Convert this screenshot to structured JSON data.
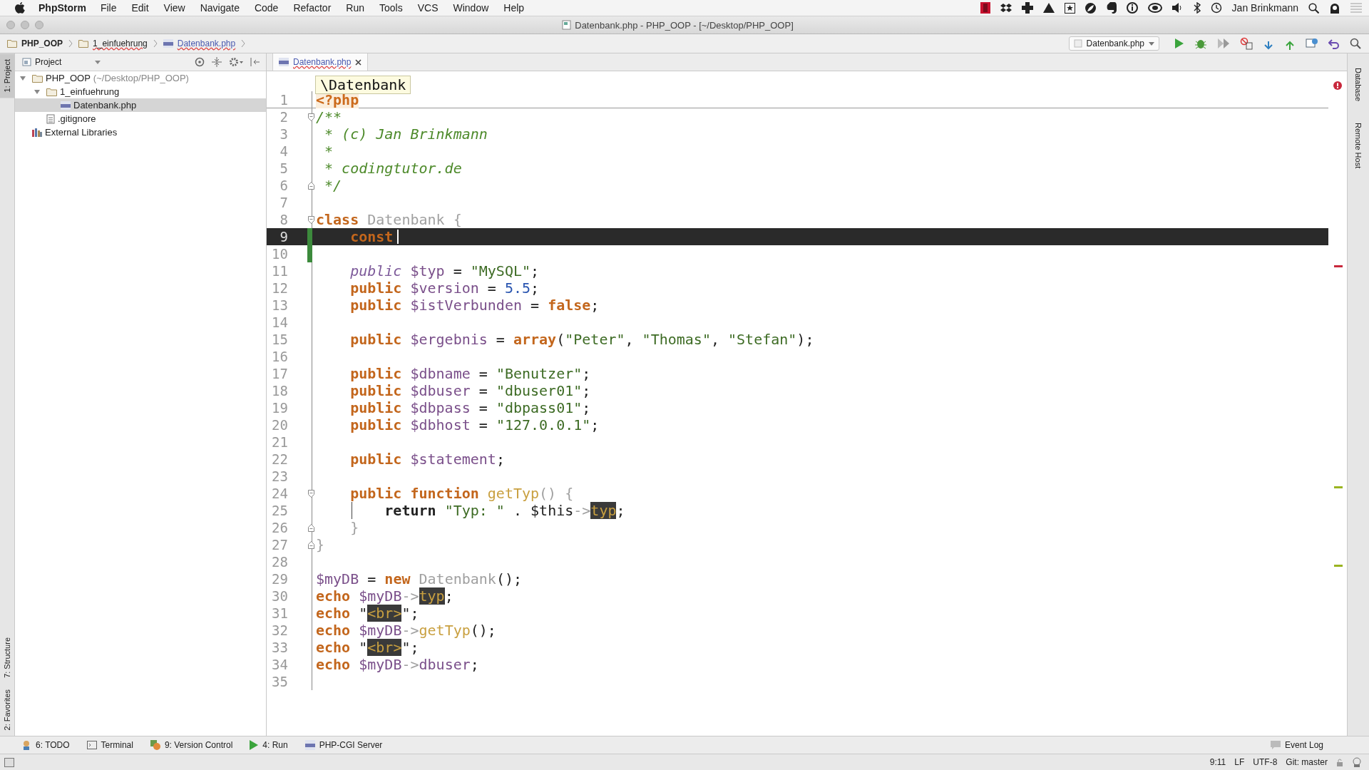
{
  "menubar": {
    "app": "PhpStorm",
    "items": [
      "File",
      "Edit",
      "View",
      "Navigate",
      "Code",
      "Refactor",
      "Run",
      "Tools",
      "VCS",
      "Window",
      "Help"
    ],
    "user": "Jan Brinkmann"
  },
  "window": {
    "title": "Datenbank.php - PHP_OOP - [~/Desktop/PHP_OOP]"
  },
  "nav_bar": {
    "breadcrumbs": [
      {
        "label": "PHP_OOP",
        "kind": "project"
      },
      {
        "label": "1_einfuehrung",
        "kind": "folder"
      },
      {
        "label": "Datenbank.php",
        "kind": "file"
      }
    ],
    "run_config": "Datenbank.php"
  },
  "left_strip": {
    "top": [
      {
        "label": "1: Project",
        "selected": true
      }
    ],
    "bottom": [
      {
        "label": "7: Structure",
        "selected": false
      },
      {
        "label": "2: Favorites",
        "selected": false
      }
    ]
  },
  "project_panel": {
    "header": "Project",
    "tree": [
      {
        "name": "PHP_OOP",
        "path": "(~/Desktop/PHP_OOP)",
        "kind": "project",
        "expanded": true,
        "selected": false,
        "children": [
          {
            "name": "1_einfuehrung",
            "kind": "folder",
            "expanded": true,
            "selected": false,
            "children": [
              {
                "name": "Datenbank.php",
                "kind": "php",
                "selected": true
              }
            ]
          },
          {
            "name": ".gitignore",
            "kind": "text",
            "selected": false
          }
        ]
      },
      {
        "name": "External Libraries",
        "kind": "library",
        "selected": false
      }
    ]
  },
  "editor": {
    "tabs": [
      {
        "label": "Datenbank.php",
        "selected": true
      }
    ],
    "breadcrumb_popup": "\\Datenbank",
    "lines": [
      {
        "number": "1",
        "tokens": [
          {
            "kind": "tag",
            "text": "<?php"
          }
        ]
      },
      {
        "number": "2",
        "fold_start": true,
        "tokens": [
          {
            "kind": "doc",
            "text": "/**"
          }
        ]
      },
      {
        "number": "3",
        "tokens": [
          {
            "kind": "doc",
            "text": " * (c) Jan Brinkmann"
          }
        ]
      },
      {
        "number": "4",
        "tokens": [
          {
            "kind": "doc",
            "text": " *"
          }
        ]
      },
      {
        "number": "5",
        "tokens": [
          {
            "kind": "doc",
            "text": " * codingtutor.de"
          }
        ]
      },
      {
        "number": "6",
        "fold_end": true,
        "tokens": [
          {
            "kind": "doc",
            "text": " */"
          }
        ]
      },
      {
        "number": "7"
      },
      {
        "number": "8",
        "fold_start": true,
        "tokens": [
          {
            "kind": "kw",
            "text": "class "
          },
          {
            "kind": "cls",
            "text": "Datenbank {"
          }
        ]
      },
      {
        "number": "9",
        "current": true,
        "changed": true,
        "tokens": [
          {
            "kind": "kw",
            "text": "    const"
          }
        ]
      },
      {
        "number": "10",
        "changed": true
      },
      {
        "number": "11",
        "tokens": [
          {
            "kind": "mod",
            "text": "    public "
          },
          {
            "kind": "var",
            "text": "$typ"
          },
          {
            "kind": "op",
            "text": " = "
          },
          {
            "kind": "str",
            "text": "\"MySQL\""
          },
          {
            "kind": "op",
            "text": ";"
          }
        ]
      },
      {
        "number": "12",
        "tokens": [
          {
            "kind": "kw",
            "text": "    public "
          },
          {
            "kind": "var",
            "text": "$version"
          },
          {
            "kind": "op",
            "text": " = "
          },
          {
            "kind": "num",
            "text": "5.5"
          },
          {
            "kind": "op",
            "text": ";"
          }
        ]
      },
      {
        "number": "13",
        "tokens": [
          {
            "kind": "kw",
            "text": "    public "
          },
          {
            "kind": "var",
            "text": "$istVerbunden"
          },
          {
            "kind": "op",
            "text": " = "
          },
          {
            "kind": "kw",
            "text": "false"
          },
          {
            "kind": "op",
            "text": ";"
          }
        ]
      },
      {
        "number": "14"
      },
      {
        "number": "15",
        "tokens": [
          {
            "kind": "kw",
            "text": "    public "
          },
          {
            "kind": "var",
            "text": "$ergebnis"
          },
          {
            "kind": "op",
            "text": " = "
          },
          {
            "kind": "kw",
            "text": "array"
          },
          {
            "kind": "op",
            "text": "("
          },
          {
            "kind": "str",
            "text": "\"Peter\""
          },
          {
            "kind": "op",
            "text": ", "
          },
          {
            "kind": "str",
            "text": "\"Thomas\""
          },
          {
            "kind": "op",
            "text": ", "
          },
          {
            "kind": "str",
            "text": "\"Stefan\""
          },
          {
            "kind": "op",
            "text": ");"
          }
        ]
      },
      {
        "number": "16"
      },
      {
        "number": "17",
        "tokens": [
          {
            "kind": "kw",
            "text": "    public "
          },
          {
            "kind": "var",
            "text": "$dbname"
          },
          {
            "kind": "op",
            "text": " = "
          },
          {
            "kind": "str",
            "text": "\"Benutzer\""
          },
          {
            "kind": "op",
            "text": ";"
          }
        ]
      },
      {
        "number": "18",
        "tokens": [
          {
            "kind": "kw",
            "text": "    public "
          },
          {
            "kind": "var",
            "text": "$dbuser"
          },
          {
            "kind": "op",
            "text": " = "
          },
          {
            "kind": "str",
            "text": "\"dbuser01\""
          },
          {
            "kind": "op",
            "text": ";"
          }
        ]
      },
      {
        "number": "19",
        "tokens": [
          {
            "kind": "kw",
            "text": "    public "
          },
          {
            "kind": "var",
            "text": "$dbpass"
          },
          {
            "kind": "op",
            "text": " = "
          },
          {
            "kind": "str",
            "text": "\"dbpass01\""
          },
          {
            "kind": "op",
            "text": ";"
          }
        ]
      },
      {
        "number": "20",
        "tokens": [
          {
            "kind": "kw",
            "text": "    public "
          },
          {
            "kind": "var",
            "text": "$dbhost"
          },
          {
            "kind": "op",
            "text": " = "
          },
          {
            "kind": "str",
            "text": "\"127.0.0.1\""
          },
          {
            "kind": "op",
            "text": ";"
          }
        ]
      },
      {
        "number": "21"
      },
      {
        "number": "22",
        "tokens": [
          {
            "kind": "kw",
            "text": "    public "
          },
          {
            "kind": "var",
            "text": "$statement"
          },
          {
            "kind": "op",
            "text": ";"
          }
        ]
      },
      {
        "number": "23"
      },
      {
        "number": "24",
        "fold_start": true,
        "tokens": [
          {
            "kind": "kw",
            "text": "    public function "
          },
          {
            "kind": "fn",
            "text": "getTyp"
          },
          {
            "kind": "cls",
            "text": "() {"
          }
        ]
      },
      {
        "number": "25",
        "indent_guide": true,
        "tokens": [
          {
            "kind": "bold",
            "text": "        return "
          },
          {
            "kind": "str",
            "text": "\"Typ: \""
          },
          {
            "kind": "op",
            "text": " . $this"
          },
          {
            "kind": "cls",
            "text": "->"
          },
          {
            "kind": "hl",
            "text": "typ"
          },
          {
            "kind": "op",
            "text": ";"
          }
        ]
      },
      {
        "number": "26",
        "fold_end": true,
        "tokens": [
          {
            "kind": "cls",
            "text": "    }"
          }
        ]
      },
      {
        "number": "27",
        "fold_end": true,
        "tokens": [
          {
            "kind": "cls",
            "text": "}"
          }
        ]
      },
      {
        "number": "28"
      },
      {
        "number": "29",
        "tokens": [
          {
            "kind": "var",
            "text": "$myDB"
          },
          {
            "kind": "op",
            "text": " = "
          },
          {
            "kind": "kw",
            "text": "new "
          },
          {
            "kind": "cls",
            "text": "Datenbank"
          },
          {
            "kind": "op",
            "text": "();"
          }
        ]
      },
      {
        "number": "30",
        "tokens": [
          {
            "kind": "kw",
            "text": "echo "
          },
          {
            "kind": "var",
            "text": "$myDB"
          },
          {
            "kind": "cls",
            "text": "->"
          },
          {
            "kind": "hl",
            "text": "typ"
          },
          {
            "kind": "op",
            "text": ";"
          }
        ]
      },
      {
        "number": "31",
        "tokens": [
          {
            "kind": "kw",
            "text": "echo "
          },
          {
            "kind": "op",
            "text": "\""
          },
          {
            "kind": "hl",
            "text": "<br>"
          },
          {
            "kind": "op",
            "text": "\";"
          }
        ]
      },
      {
        "number": "32",
        "tokens": [
          {
            "kind": "kw",
            "text": "echo "
          },
          {
            "kind": "var",
            "text": "$myDB"
          },
          {
            "kind": "cls",
            "text": "->"
          },
          {
            "kind": "fn",
            "text": "getTyp"
          },
          {
            "kind": "op",
            "text": "();"
          }
        ]
      },
      {
        "number": "33",
        "tokens": [
          {
            "kind": "kw",
            "text": "echo "
          },
          {
            "kind": "op",
            "text": "\""
          },
          {
            "kind": "hl",
            "text": "<br>"
          },
          {
            "kind": "op",
            "text": "\";"
          }
        ]
      },
      {
        "number": "34",
        "tokens": [
          {
            "kind": "kw",
            "text": "echo "
          },
          {
            "kind": "var",
            "text": "$myDB"
          },
          {
            "kind": "cls",
            "text": "->"
          },
          {
            "kind": "var",
            "text": "dbuser"
          },
          {
            "kind": "op",
            "text": ";"
          }
        ]
      },
      {
        "number": "35"
      }
    ]
  },
  "right_strip": [
    "Database",
    "Remote Host"
  ],
  "tool_windows": [
    {
      "label": "6: TODO",
      "kind": "todo"
    },
    {
      "label": "Terminal",
      "kind": "terminal"
    },
    {
      "label": "9: Version Control",
      "kind": "vcs"
    },
    {
      "label": "4: Run",
      "kind": "run"
    },
    {
      "label": "PHP-CGI Server",
      "kind": "php"
    }
  ],
  "event_log": "Event Log",
  "status_bar": [
    "9:11",
    "LF",
    "UTF-8",
    "Git: master"
  ]
}
